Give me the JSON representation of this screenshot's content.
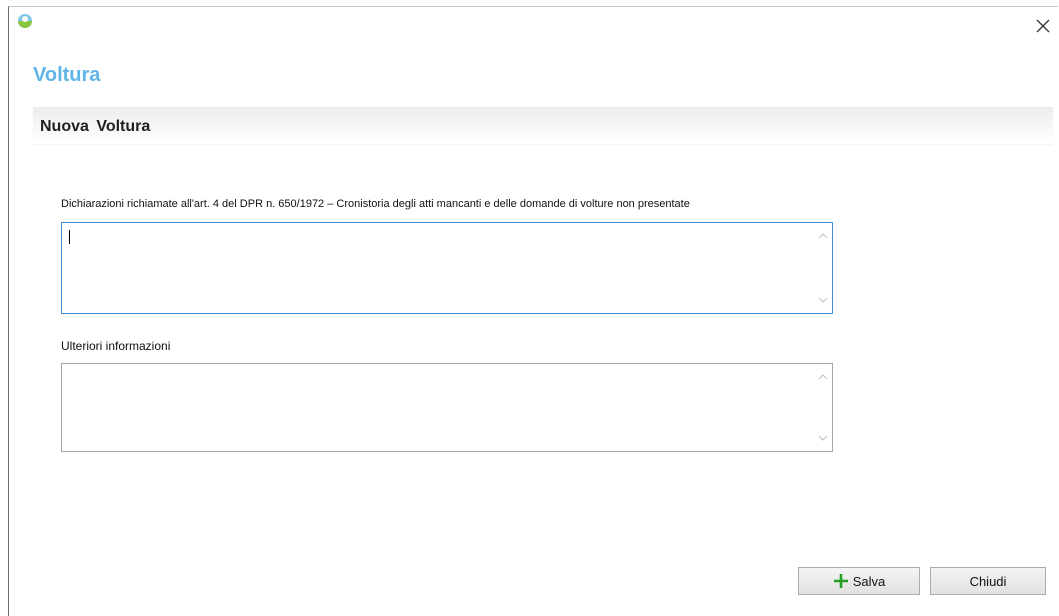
{
  "window": {
    "close_icon": "close-icon",
    "app_icon": "app-logo-icon"
  },
  "header": {
    "title": "Voltura",
    "section_title": "Nuova Voltura"
  },
  "form": {
    "declarations_label": "Dichiarazioni richiamate all'art. 4 del DPR n. 650/1972 – Cronistoria degli atti mancanti e delle domande di volture non presentate",
    "declarations_value": "",
    "further_info_label": "Ulteriori informazioni",
    "further_info_value": ""
  },
  "actions": {
    "save_label": "Salva",
    "close_label": "Chiudi",
    "save_icon": "plus-icon"
  },
  "colors": {
    "title": "#5fb4e8",
    "focus_border": "#3c8ed8",
    "plus_green": "#22a022"
  }
}
